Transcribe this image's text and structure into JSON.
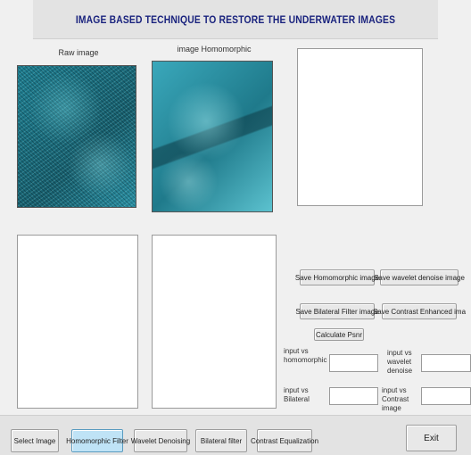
{
  "title": "IMAGE BASED TECHNIQUE TO RESTORE THE UNDERWATER IMAGES",
  "captions": {
    "raw": "Raw image",
    "homomorphic": "image Homomorphic"
  },
  "buttons": {
    "save_homomorphic": "Save Homomorphic image",
    "save_wavelet": "Save wavelet denoise image",
    "save_bilateral": "Save Bilateral Filter image",
    "save_contrast": "Save Contrast Enhanced ima",
    "calculate_psnr": "Calculate Psnr"
  },
  "psnr_labels": {
    "input_homomorphic": "input vs homomorphic",
    "input_wavelet": "input vs wavelet denoise",
    "input_bilateral": "input vs Bilateral",
    "input_contrast": "input vs Contrast image"
  },
  "psnr_values": {
    "input_homomorphic": "",
    "input_wavelet": "",
    "input_bilateral": "",
    "input_contrast": ""
  },
  "toolbar": {
    "select_image": "Select Image",
    "homomorphic_filter": "Homomorphic Filter",
    "wavelet_denoising": "Wavelet Denoising",
    "bilateral_filter": "Bilateral filter",
    "contrast_equalization": "Contrast Equalization",
    "exit": "Exit"
  },
  "active_button": "homomorphic_filter",
  "accent_color": "#1a237e",
  "image_tint": "#1f8a9c"
}
